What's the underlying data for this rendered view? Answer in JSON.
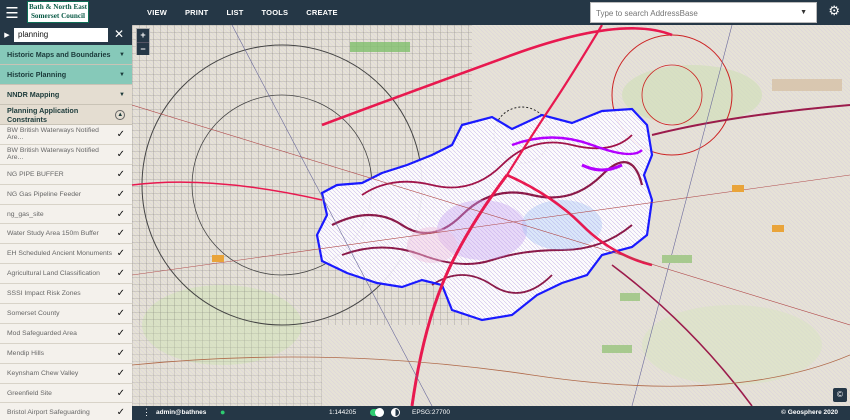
{
  "header": {
    "logo_line1": "Bath & North East",
    "logo_line2": "Somerset Council",
    "nav": [
      "VIEW",
      "PRINT",
      "LIST",
      "TOOLS",
      "CREATE"
    ],
    "search_placeholder": "Type to search AddressBase",
    "menu_icon": "hamburger-icon",
    "settings_icon": "gear-icon"
  },
  "sidebar": {
    "search_value": "planning",
    "categories": [
      {
        "label": "Historic Maps and Boundaries",
        "state": "collapsed"
      },
      {
        "label": "Historic Planning",
        "state": "collapsed"
      },
      {
        "label": "NNDR Mapping",
        "state": "collapsed"
      },
      {
        "label": "Planning Application Constraints",
        "state": "expanded"
      }
    ],
    "layers": [
      "BW British Waterways Notified Are...",
      "BW British Waterways Notified Are...",
      "NG PIPE BUFFER",
      "NG Gas Pipeline Feeder",
      "ng_gas_site",
      "Water Study Area 150m Buffer",
      "EH Scheduled Ancient Monuments",
      "Agricultural Land Classification",
      "SSSI Impact Risk Zones",
      "Somerset County",
      "Mod Safeguarded Area",
      "Mendip Hills",
      "Keynsham Chew Valley",
      "Greenfield Site",
      "Bristol Airport Safeguarding"
    ]
  },
  "map": {
    "zoom_in": "+",
    "zoom_out": "−",
    "boundary_color": "#1a1aff",
    "road_color": "#e8194f",
    "river_color": "#b300ff"
  },
  "statusbar": {
    "user": "admin@bathnes",
    "scale": "1:144205",
    "epsg": "EPSG:27700",
    "copyright": "© Geosphere 2020"
  }
}
